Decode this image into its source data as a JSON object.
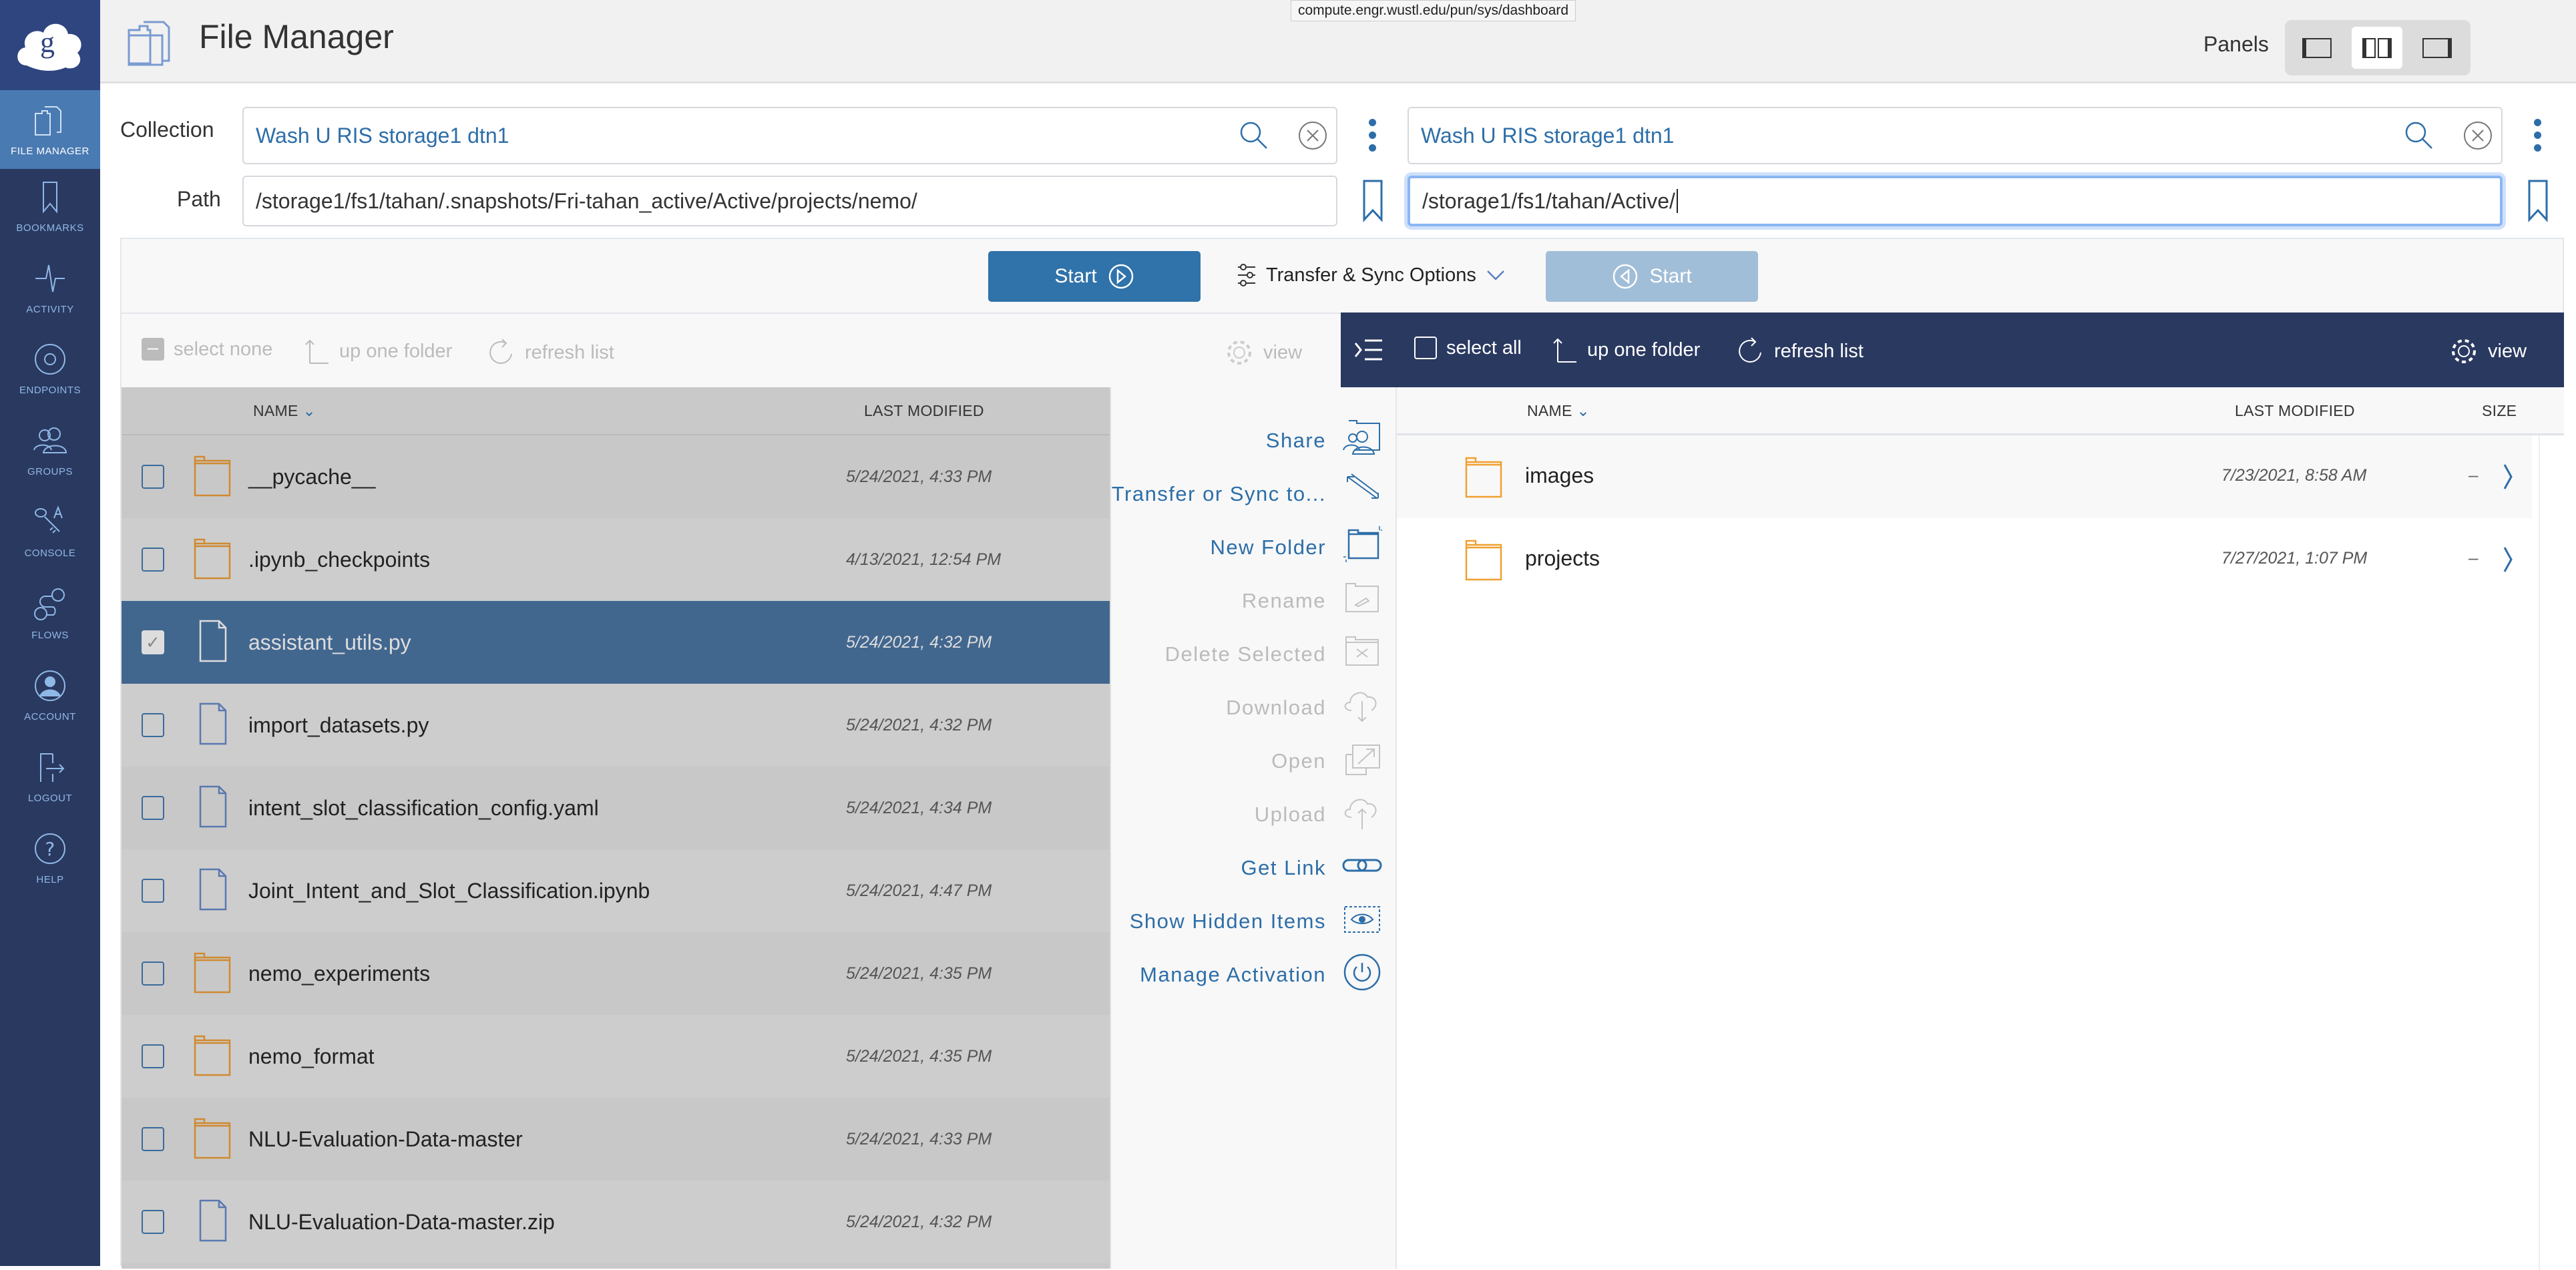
{
  "sidebar": {
    "items": [
      {
        "label": "FILE MANAGER",
        "icon": "file-manager-icon",
        "active": true
      },
      {
        "label": "BOOKMARKS",
        "icon": "bookmark-icon"
      },
      {
        "label": "ACTIVITY",
        "icon": "activity-icon"
      },
      {
        "label": "ENDPOINTS",
        "icon": "endpoints-icon"
      },
      {
        "label": "GROUPS",
        "icon": "groups-icon"
      },
      {
        "label": "CONSOLE",
        "icon": "console-icon"
      },
      {
        "label": "FLOWS",
        "icon": "flows-icon"
      },
      {
        "label": "ACCOUNT",
        "icon": "account-icon"
      },
      {
        "label": "LOGOUT",
        "icon": "logout-icon"
      },
      {
        "label": "HELP",
        "icon": "help-icon"
      }
    ]
  },
  "header": {
    "title": "File Manager",
    "tooltip": "compute.engr.wustl.edu/pun/sys/dashboard",
    "panels_label": "Panels",
    "panels_selected": "two-panel"
  },
  "form": {
    "collection_label": "Collection",
    "path_label": "Path",
    "left": {
      "collection": "Wash U RIS storage1 dtn1",
      "path": "/storage1/fs1/tahan/.snapshots/Fri-tahan_active/Active/projects/nemo/"
    },
    "right": {
      "collection": "Wash U RIS storage1 dtn1",
      "path": "/storage1/fs1/tahan/Active/"
    }
  },
  "transfer": {
    "start_left": "Start",
    "options": "Transfer & Sync Options",
    "start_right": "Start"
  },
  "left_toolbar": {
    "select": "select none",
    "up": "up one folder",
    "refresh": "refresh list",
    "view": "view"
  },
  "right_toolbar": {
    "select": "select all",
    "up": "up one folder",
    "refresh": "refresh list",
    "view": "view"
  },
  "columns": {
    "name": "NAME",
    "modified": "LAST MODIFIED",
    "size": "SIZE"
  },
  "left_files": [
    {
      "name": "__pycache__",
      "type": "folder",
      "modified": "5/24/2021, 4:33 PM"
    },
    {
      "name": ".ipynb_checkpoints",
      "type": "folder",
      "modified": "4/13/2021, 12:54 PM"
    },
    {
      "name": "assistant_utils.py",
      "type": "file",
      "modified": "5/24/2021, 4:32 PM",
      "selected": true
    },
    {
      "name": "import_datasets.py",
      "type": "file",
      "modified": "5/24/2021, 4:32 PM"
    },
    {
      "name": "intent_slot_classification_config.yaml",
      "type": "file",
      "modified": "5/24/2021, 4:34 PM"
    },
    {
      "name": "Joint_Intent_and_Slot_Classification.ipynb",
      "type": "file",
      "modified": "5/24/2021, 4:47 PM"
    },
    {
      "name": "nemo_experiments",
      "type": "folder",
      "modified": "5/24/2021, 4:35 PM"
    },
    {
      "name": "nemo_format",
      "type": "folder",
      "modified": "5/24/2021, 4:35 PM"
    },
    {
      "name": "NLU-Evaluation-Data-master",
      "type": "folder",
      "modified": "5/24/2021, 4:33 PM"
    },
    {
      "name": "NLU-Evaluation-Data-master.zip",
      "type": "file",
      "modified": "5/24/2021, 4:32 PM"
    }
  ],
  "menu": [
    {
      "label": "Share",
      "enabled": true,
      "icon": "share-icon"
    },
    {
      "label": "Transfer or Sync to...",
      "enabled": true,
      "icon": "transfer-icon"
    },
    {
      "label": "New Folder",
      "enabled": true,
      "icon": "new-folder-icon"
    },
    {
      "label": "Rename",
      "enabled": false,
      "icon": "rename-icon"
    },
    {
      "label": "Delete Selected",
      "enabled": false,
      "icon": "delete-icon"
    },
    {
      "label": "Download",
      "enabled": false,
      "icon": "download-icon"
    },
    {
      "label": "Open",
      "enabled": false,
      "icon": "open-icon"
    },
    {
      "label": "Upload",
      "enabled": false,
      "icon": "upload-icon"
    },
    {
      "label": "Get Link",
      "enabled": true,
      "icon": "link-icon"
    },
    {
      "label": "Show Hidden Items",
      "enabled": true,
      "icon": "eye-icon"
    },
    {
      "label": "Manage Activation",
      "enabled": true,
      "icon": "power-icon"
    }
  ],
  "right_files": [
    {
      "name": "images",
      "type": "folder",
      "modified": "7/23/2021, 8:58 AM",
      "size": "–"
    },
    {
      "name": "projects",
      "type": "folder",
      "modified": "7/27/2021, 1:07 PM",
      "size": "–"
    }
  ],
  "colors": {
    "sidebar": "#2a3960",
    "active": "#4a7ab2",
    "accent": "#2d6ea8",
    "folder": "#f0a030",
    "selected_row": "#42678f"
  }
}
